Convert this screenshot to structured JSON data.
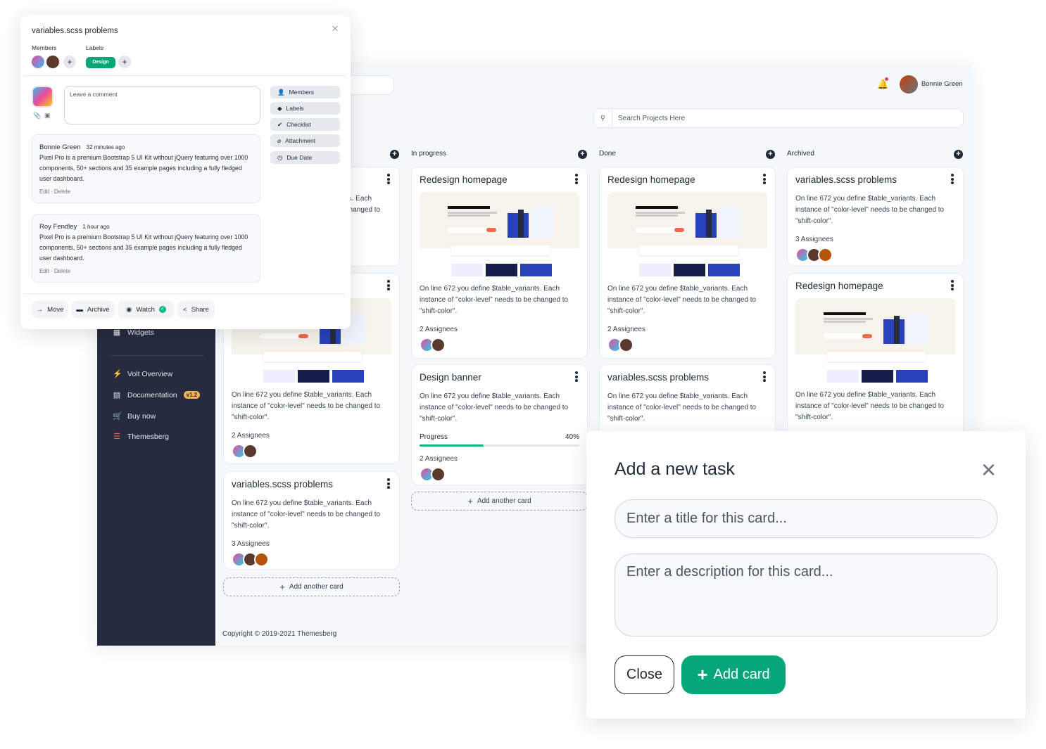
{
  "header": {
    "search_placeholder": "Search Projects Here",
    "user_name": "Bonnie Green",
    "notification_dot_color": "#f43f5e"
  },
  "sidebar": {
    "items": [
      {
        "label": "Widgets",
        "icon": "grid-icon"
      },
      {
        "label": "Volt Overview",
        "icon": "bolt-icon"
      },
      {
        "label": "Documentation",
        "icon": "book-icon",
        "badge": "v1.2"
      },
      {
        "label": "Buy now",
        "icon": "cart-icon"
      },
      {
        "label": "Themesberg",
        "icon": "themesberg-logo-icon"
      }
    ]
  },
  "columns": [
    {
      "title": "",
      "cards": [
        {
          "title": "",
          "desc": "On line 672 you define $table_variants. Each instance of \"color-level\" needs to be changed to \"shift-color\".",
          "assignees": "",
          "avatars": 0
        },
        {
          "title": "",
          "image": true,
          "desc": "On line 672 you define $table_variants. Each instance of \"color-level\" needs to be changed to \"shift-color\".",
          "assignees": "2 Assignees",
          "avatars": 2
        },
        {
          "title": "variables.scss problems",
          "desc": "On line 672 you define $table_variants. Each instance of \"color-level\" needs to be changed to \"shift-color\".",
          "assignees": "3 Assignees",
          "avatars": 3
        }
      ],
      "add_label": "Add another card"
    },
    {
      "title": "In progress",
      "cards": [
        {
          "title": "Redesign homepage",
          "image": true,
          "desc": "On line 672 you define $table_variants. Each instance of \"color-level\" needs to be changed to \"shift-color\".",
          "assignees": "2 Assignees",
          "avatars": 2
        },
        {
          "title": "Design banner",
          "desc": "On line 672 you define $table_variants. Each instance of \"color-level\" needs to be changed to \"shift-color\".",
          "progress_label": "Progress",
          "progress_value": "40%",
          "progress": 40,
          "assignees": "2 Assignees",
          "avatars": 2
        }
      ],
      "add_label": "Add another card"
    },
    {
      "title": "Done",
      "cards": [
        {
          "title": "Redesign homepage",
          "image": true,
          "desc": "On line 672 you define $table_variants. Each instance of \"color-level\" needs to be changed to \"shift-color\".",
          "assignees": "2 Assignees",
          "avatars": 2
        },
        {
          "title": "variables.scss problems",
          "desc": "On line 672 you define $table_variants. Each instance of \"color-level\" needs to be changed to \"shift-color\".",
          "assignees": "",
          "avatars": 0
        }
      ]
    },
    {
      "title": "Archived",
      "cards": [
        {
          "title": "variables.scss problems",
          "desc": "On line 672 you define $table_variants. Each instance of \"color-level\" needs to be changed to \"shift-color\".",
          "assignees": "3 Assignees",
          "avatars": 3
        },
        {
          "title": "Redesign homepage",
          "image": true,
          "desc": "On line 672 you define $table_variants. Each instance of \"color-level\" needs to be changed to \"shift-color\".",
          "assignees": "",
          "avatars": 0
        }
      ]
    }
  ],
  "footer": {
    "copyright": "Copyright © 2019-2021 Themesberg"
  },
  "card_modal": {
    "title": "variables.scss problems",
    "members_label": "Members",
    "labels_label": "Labels",
    "label_badge": "Design",
    "label_color": "#05a677",
    "comment_placeholder": "Leave a comment",
    "side_buttons": [
      "Members",
      "Labels",
      "Checklist",
      "Attachment",
      "Due Date"
    ],
    "comments": [
      {
        "name": "Bonnie Green",
        "time": "32 minutes ago",
        "text": "Pixel Pro is a premium Bootstrap 5 UI Kit without jQuery featuring over 1000 components, 50+ sections and 35 example pages including a fully fledged user dashboard.",
        "actions": "Edit · Delete"
      },
      {
        "name": "Roy Fendley",
        "time": "1 hour ago",
        "text": "Pixel Pro is a premium Bootstrap 5 UI Kit without jQuery featuring over 1000 components, 50+ sections and 35 example pages including a fully fledged user dashboard.",
        "actions": "Edit · Delete"
      }
    ],
    "footer_buttons": [
      "Move",
      "Archive",
      "Watch",
      "Share"
    ]
  },
  "task_modal": {
    "title": "Add a new task",
    "title_placeholder": "Enter a title for this card...",
    "desc_placeholder": "Enter a description for this card...",
    "close_label": "Close",
    "add_label": "Add card",
    "accent": "#05a677"
  }
}
